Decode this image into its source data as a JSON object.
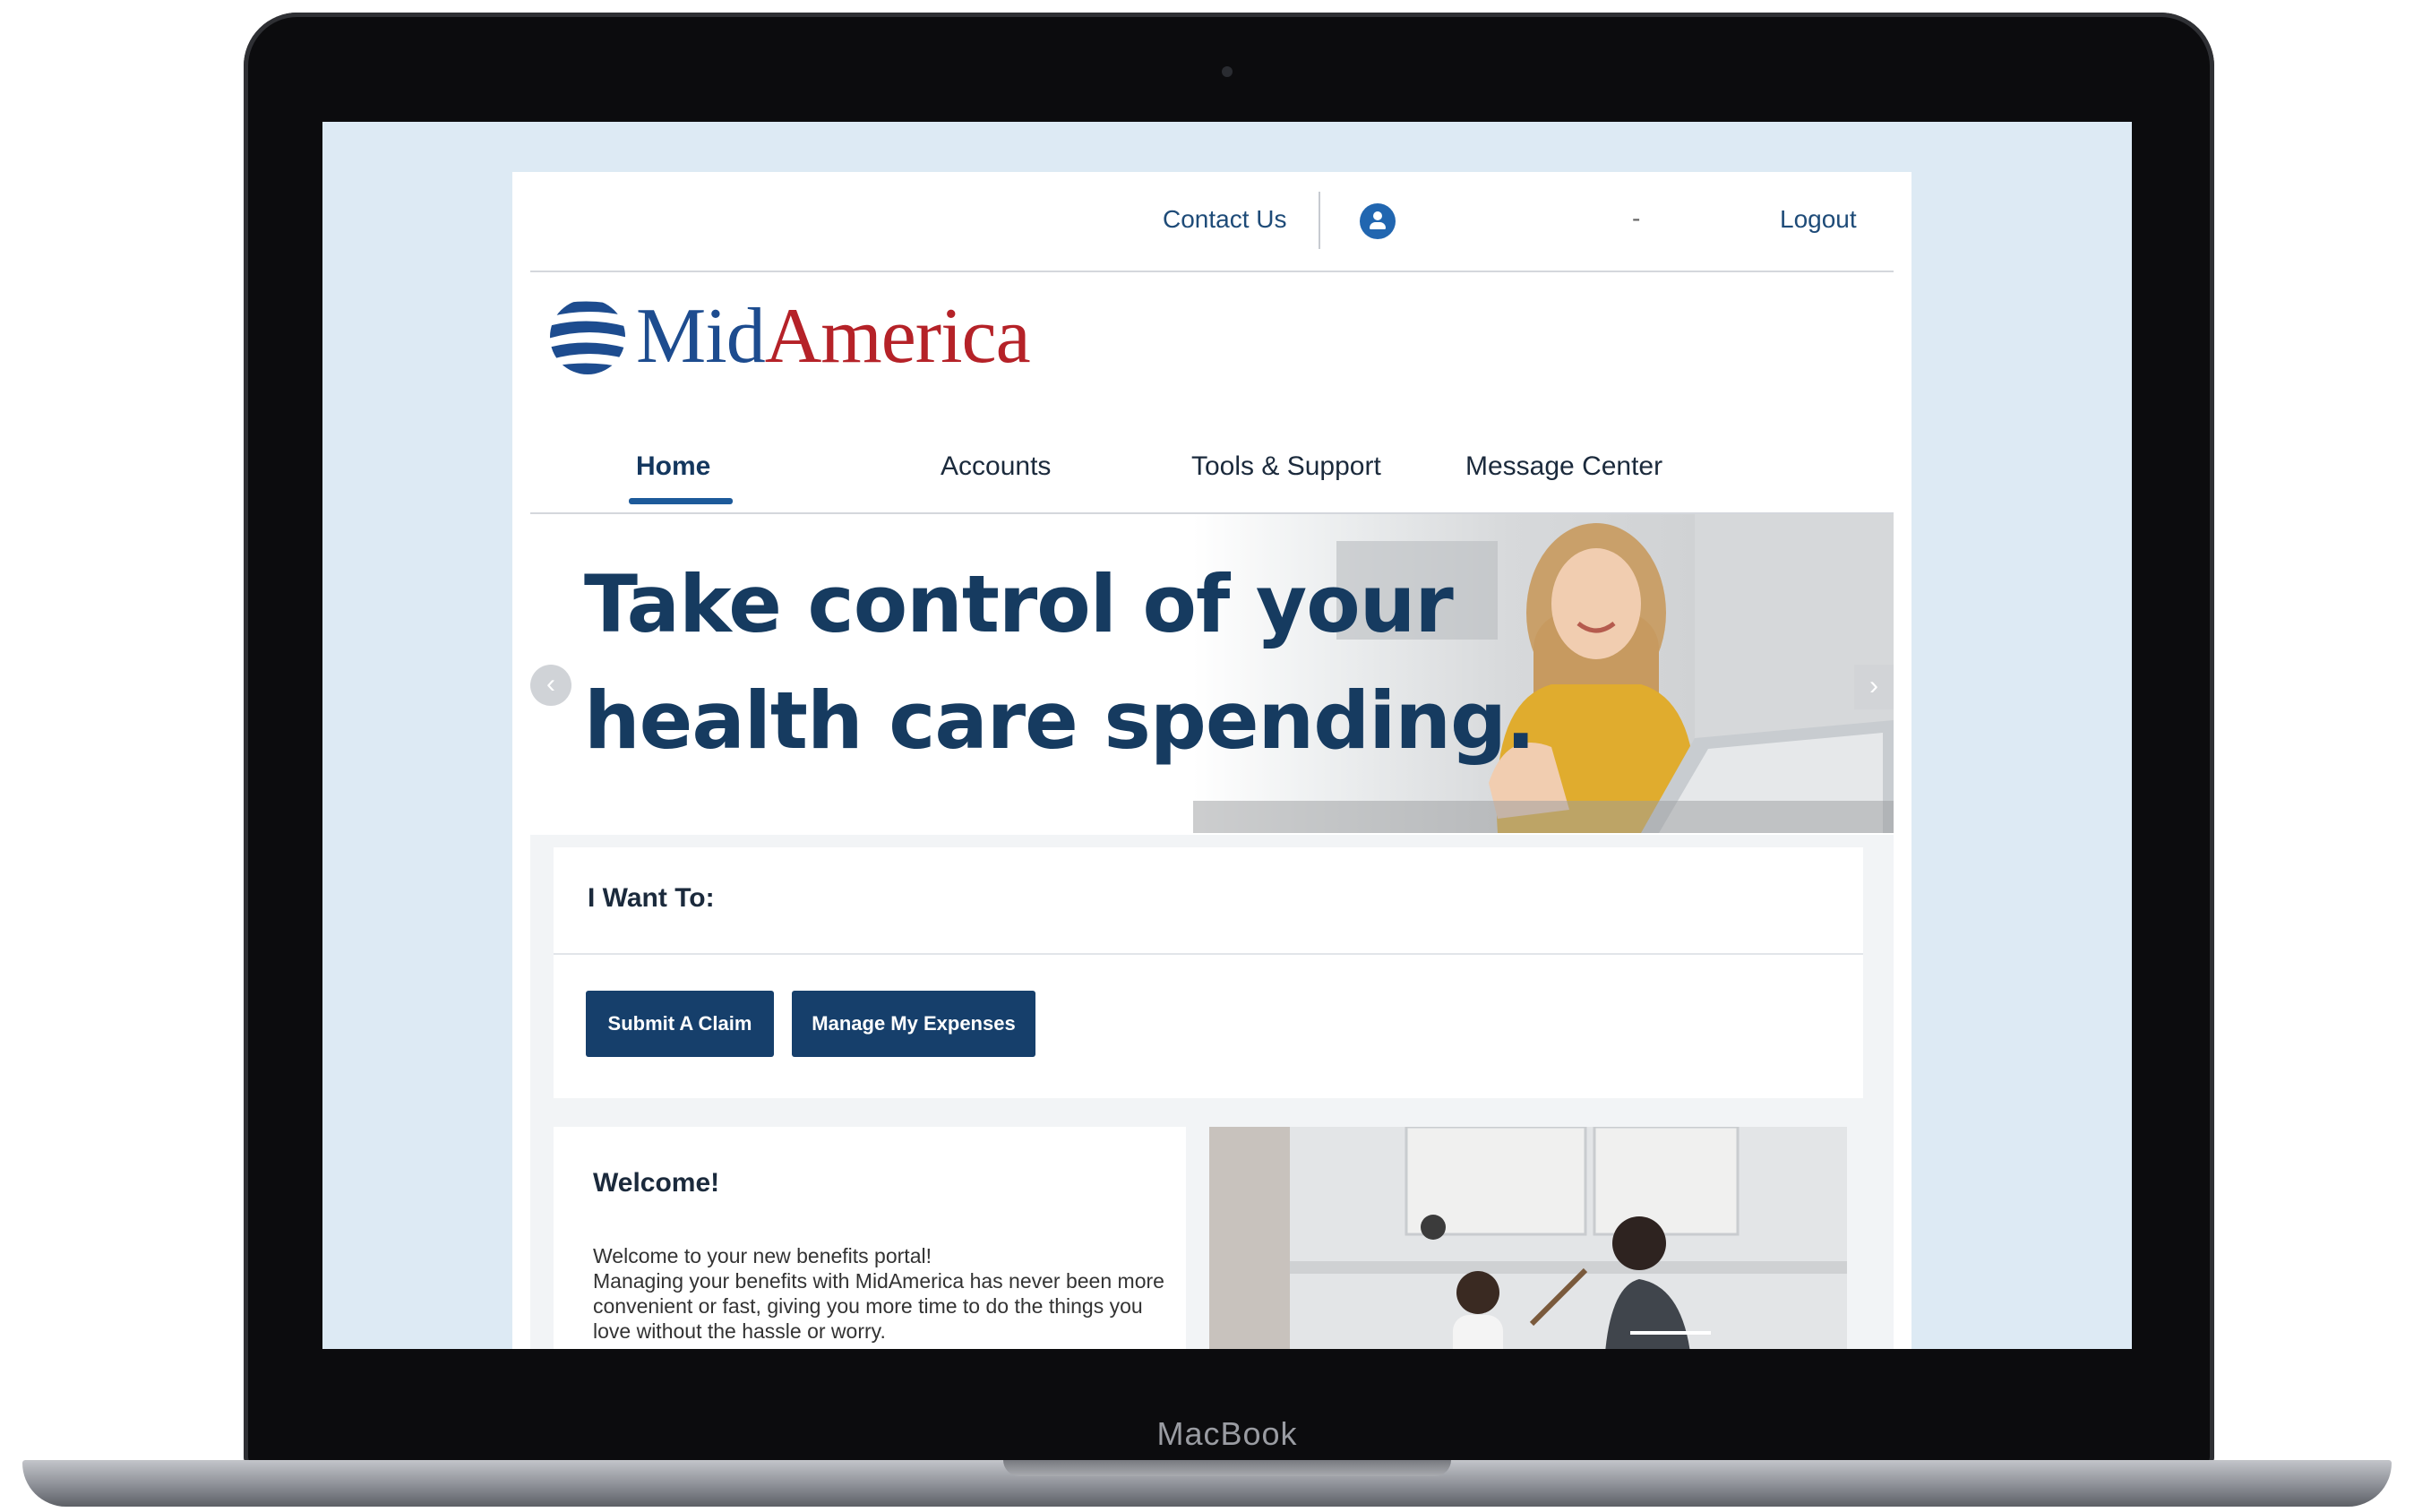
{
  "device": {
    "label": "MacBook"
  },
  "utility_bar": {
    "contact_label": "Contact Us",
    "user_name": "-",
    "logout_label": "Logout"
  },
  "brand": {
    "logo_mid": "Mid",
    "logo_america": "America",
    "colors": {
      "navy": "#1d4c8f",
      "red": "#b52228"
    }
  },
  "nav": {
    "items": [
      {
        "label": "Home",
        "active": true
      },
      {
        "label": "Accounts",
        "active": false
      },
      {
        "label": "Tools & Support",
        "active": false
      },
      {
        "label": "Message Center",
        "active": false
      }
    ]
  },
  "hero": {
    "headline": "Take control of your\nhealth care spending.",
    "prev_icon": "chevron-left-icon",
    "next_icon": "chevron-right-icon"
  },
  "i_want_to": {
    "label": "I Want To:",
    "buttons": [
      {
        "label": "Submit A Claim"
      },
      {
        "label": "Manage My Expenses"
      }
    ]
  },
  "welcome": {
    "title": "Welcome!",
    "line1": "Welcome to your new benefits portal!",
    "line2": "Managing your benefits with MidAmerica has never been more convenient or fast, giving you more time to do the things you love without the hassle or worry."
  },
  "colors": {
    "screen_bg": "#ddeaf4",
    "button_bg": "#163f6b",
    "headline": "#163b60",
    "nav_active_underline": "#1d5a9a"
  }
}
